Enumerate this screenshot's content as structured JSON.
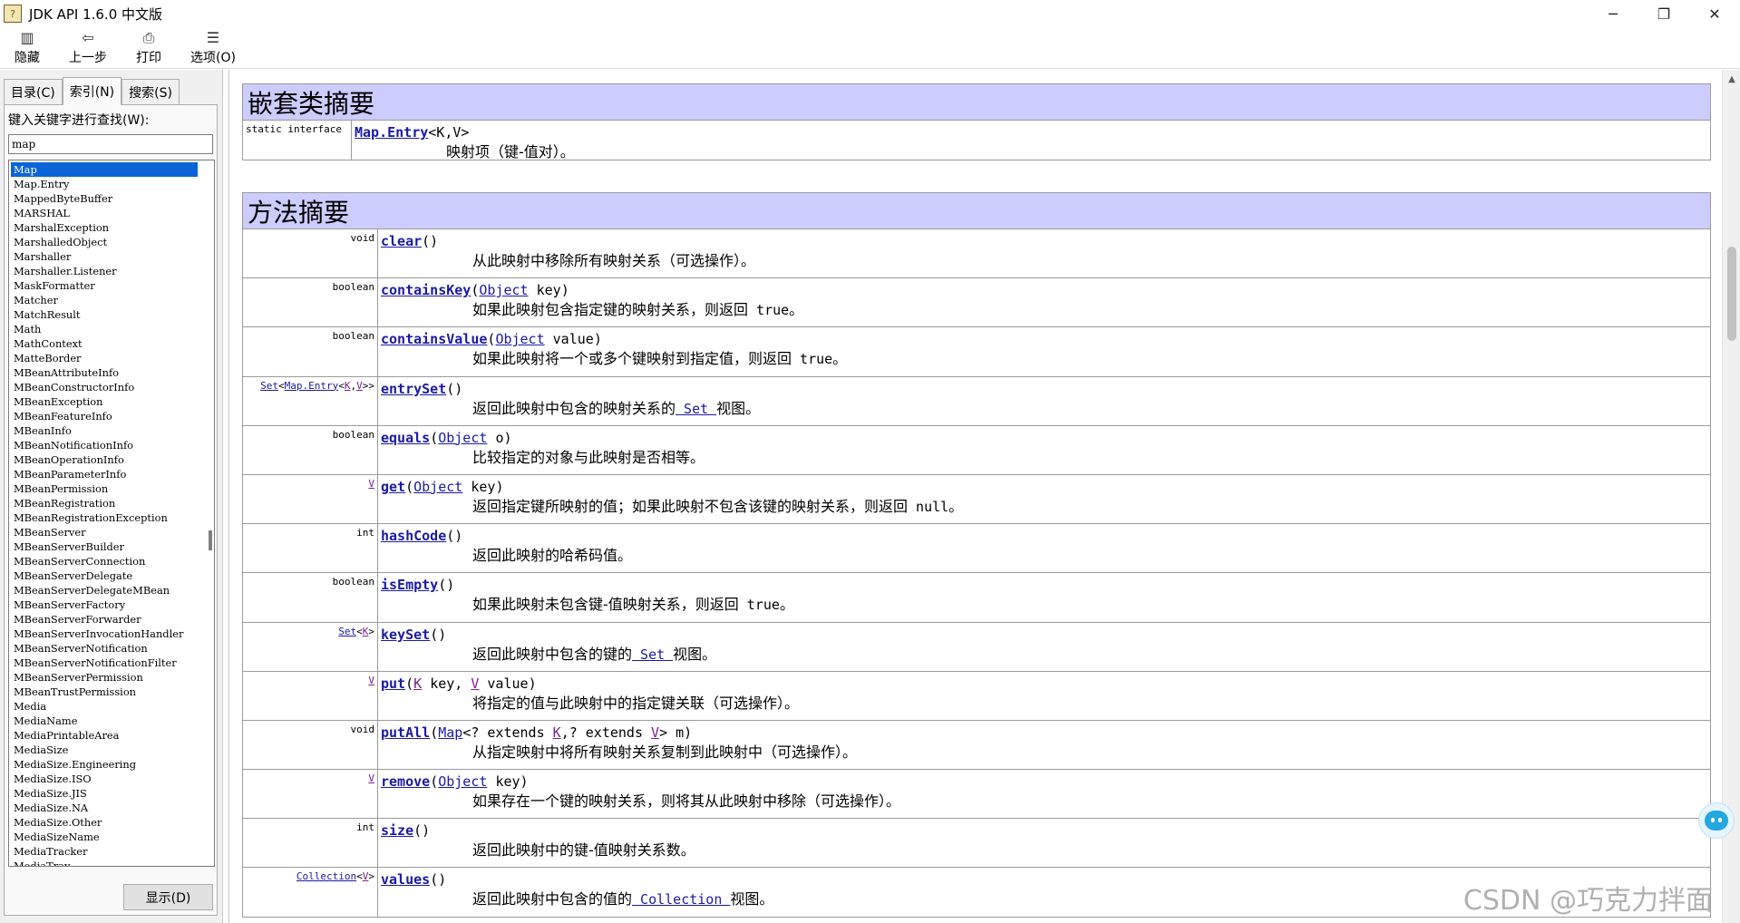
{
  "window": {
    "title": "JDK API 1.6.0 中文版",
    "icon": "help-book-icon",
    "controls": [
      "─",
      "❐",
      "✕"
    ]
  },
  "toolbar": {
    "buttons": [
      {
        "label": "隐藏",
        "icon": "hide-pane-icon",
        "glyph": "▥"
      },
      {
        "label": "上一步",
        "icon": "back-arrow-icon",
        "glyph": "⇦"
      },
      {
        "label": "打印",
        "icon": "printer-icon",
        "glyph": "⎙"
      },
      {
        "label": "选项(O)",
        "icon": "options-icon",
        "glyph": "☰"
      }
    ]
  },
  "left_pane": {
    "tabs": [
      "目录(C)",
      "索引(N)",
      "搜索(S)"
    ],
    "active_tab": "索引(N)",
    "search_label": "键入关键字进行查找(W):",
    "search_value": "map",
    "selected_item": "Map",
    "items": [
      "Map",
      "Map.Entry",
      "MappedByteBuffer",
      "MARSHAL",
      "MarshalException",
      "MarshalledObject",
      "Marshaller",
      "Marshaller.Listener",
      "MaskFormatter",
      "Matcher",
      "MatchResult",
      "Math",
      "MathContext",
      "MatteBorder",
      "MBeanAttributeInfo",
      "MBeanConstructorInfo",
      "MBeanException",
      "MBeanFeatureInfo",
      "MBeanInfo",
      "MBeanNotificationInfo",
      "MBeanOperationInfo",
      "MBeanParameterInfo",
      "MBeanPermission",
      "MBeanRegistration",
      "MBeanRegistrationException",
      "MBeanServer",
      "MBeanServerBuilder",
      "MBeanServerConnection",
      "MBeanServerDelegate",
      "MBeanServerDelegateMBean",
      "MBeanServerFactory",
      "MBeanServerForwarder",
      "MBeanServerInvocationHandler",
      "MBeanServerNotification",
      "MBeanServerNotificationFilter",
      "MBeanServerPermission",
      "MBeanTrustPermission",
      "Media",
      "MediaName",
      "MediaPrintableArea",
      "MediaSize",
      "MediaSize.Engineering",
      "MediaSize.ISO",
      "MediaSize.JIS",
      "MediaSize.NA",
      "MediaSize.Other",
      "MediaSizeName",
      "MediaTracker",
      "MediaTray"
    ],
    "display_button": "显示(D)"
  },
  "nested": {
    "heading": "嵌套类摘要",
    "rows": [
      {
        "type": "static interface",
        "sig_name": "Map.Entry",
        "sig_params": "<K,V>",
        "desc": "映射项（键-值对）。"
      }
    ]
  },
  "methods": {
    "heading": "方法摘要",
    "rows": [
      {
        "type": "void",
        "name": "clear",
        "args": "()",
        "desc": "从此映射中移除所有映射关系（可选操作）。"
      },
      {
        "type": "boolean",
        "name": "containsKey",
        "args": "(Object key)",
        "desc": "如果此映射包含指定键的映射关系，则返回 true。"
      },
      {
        "type": "boolean",
        "name": "containsValue",
        "args": "(Object value)",
        "desc": "如果此映射将一个或多个键映射到指定值，则返回 true。"
      },
      {
        "type": "Set<Map.Entry<K,V>>",
        "name": "entrySet",
        "args": "()",
        "desc": "返回此映射中包含的映射关系的 Set 视图。"
      },
      {
        "type": "boolean",
        "name": "equals",
        "args": "(Object o)",
        "desc": "比较指定的对象与此映射是否相等。"
      },
      {
        "type": "V",
        "name": "get",
        "args": "(Object key)",
        "desc": "返回指定键所映射的值；如果此映射不包含该键的映射关系，则返回 null。"
      },
      {
        "type": "int",
        "name": "hashCode",
        "args": "()",
        "desc": "返回此映射的哈希码值。"
      },
      {
        "type": "boolean",
        "name": "isEmpty",
        "args": "()",
        "desc": "如果此映射未包含键-值映射关系，则返回 true。"
      },
      {
        "type": "Set<K>",
        "name": "keySet",
        "args": "()",
        "desc": "返回此映射中包含的键的 Set 视图。"
      },
      {
        "type": "V",
        "name": "put",
        "args": "(K key, V value)",
        "desc": "将指定的值与此映射中的指定键关联（可选操作）。"
      },
      {
        "type": "void",
        "name": "putAll",
        "args": "(Map<? extends K,? extends V> m)",
        "desc": "从指定映射中将所有映射关系复制到此映射中（可选操作）。"
      },
      {
        "type": "V",
        "name": "remove",
        "args": "(Object key)",
        "desc": "如果存在一个键的映射关系，则将其从此映射中移除（可选操作）。"
      },
      {
        "type": "int",
        "name": "size",
        "args": "()",
        "desc": "返回此映射中的键-值映射关系数。"
      },
      {
        "type": "Collection<V>",
        "name": "values",
        "args": "()",
        "desc": "返回此映射中包含的值的 Collection 视图。"
      }
    ]
  },
  "watermark": "CSDN @巧克力拌面",
  "colors": {
    "section_header": "#ccccff",
    "link": "#1a1aa6",
    "type_param": "#7a1f8a",
    "selection": "#0a64d8"
  }
}
